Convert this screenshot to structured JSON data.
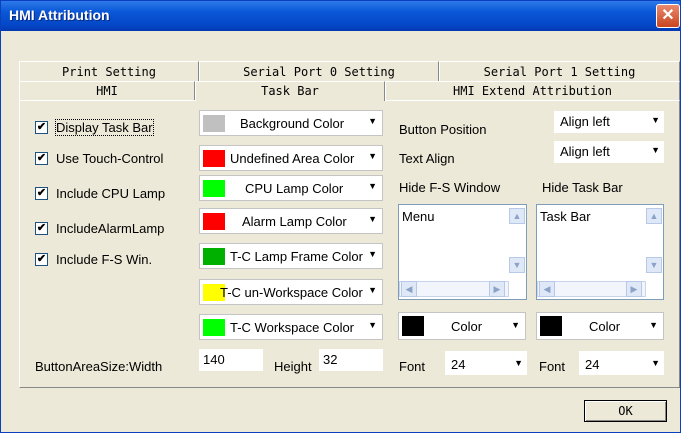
{
  "window": {
    "title": "HMI Attribution",
    "close_glyph": "✕"
  },
  "tabs_row1": [
    {
      "label": "Print Setting"
    },
    {
      "label": "Serial Port 0 Setting"
    },
    {
      "label": "Serial Port 1 Setting"
    }
  ],
  "tabs_row2": [
    {
      "label": "HMI"
    },
    {
      "label": "Task Bar"
    },
    {
      "label": "HMI Extend Attribution"
    }
  ],
  "checkboxes": [
    {
      "label": "Display Task Bar",
      "checked": true
    },
    {
      "label": "Use Touch-Control",
      "checked": true
    },
    {
      "label": "Include CPU Lamp",
      "checked": true
    },
    {
      "label": "IncludeAlarmLamp",
      "checked": true
    },
    {
      "label": "Include F-S Win.",
      "checked": true
    }
  ],
  "color_buttons": [
    {
      "label": "Background Color",
      "swatch": "#c0c0c0"
    },
    {
      "label": "Undefined Area Color",
      "swatch": "#ff0000"
    },
    {
      "label": "CPU Lamp Color",
      "swatch": "#00ff00"
    },
    {
      "label": "Alarm Lamp Color",
      "swatch": "#ff0000"
    },
    {
      "label": "T-C Lamp Frame Color",
      "swatch": "#00b000"
    },
    {
      "label": "T-C un-Workspace Color",
      "swatch": "#ffff00"
    },
    {
      "label": "T-C Workspace Color",
      "swatch": "#00ff00"
    }
  ],
  "button_area": {
    "label": "ButtonAreaSize:Width",
    "width": "140",
    "height_label": "Height",
    "height": "32"
  },
  "right": {
    "button_position_label": "Button Position",
    "button_position_value": "Align left",
    "text_align_label": "Text Align",
    "text_align_value": "Align left",
    "hide_fs_label": "Hide F-S Window",
    "hide_tb_label": "Hide Task Bar",
    "hide_fs_item": "Menu",
    "hide_tb_item": "Task Bar",
    "color_left_label": "Color",
    "color_right_label": "Color",
    "font_label_left": "Font",
    "font_value_left": "24",
    "font_label_right": "Font",
    "font_value_right": "24"
  },
  "ok_label": "OK",
  "glyphs": {
    "check": "✔",
    "down": "▼",
    "up": "▲",
    "left": "◀",
    "right": "▶"
  }
}
